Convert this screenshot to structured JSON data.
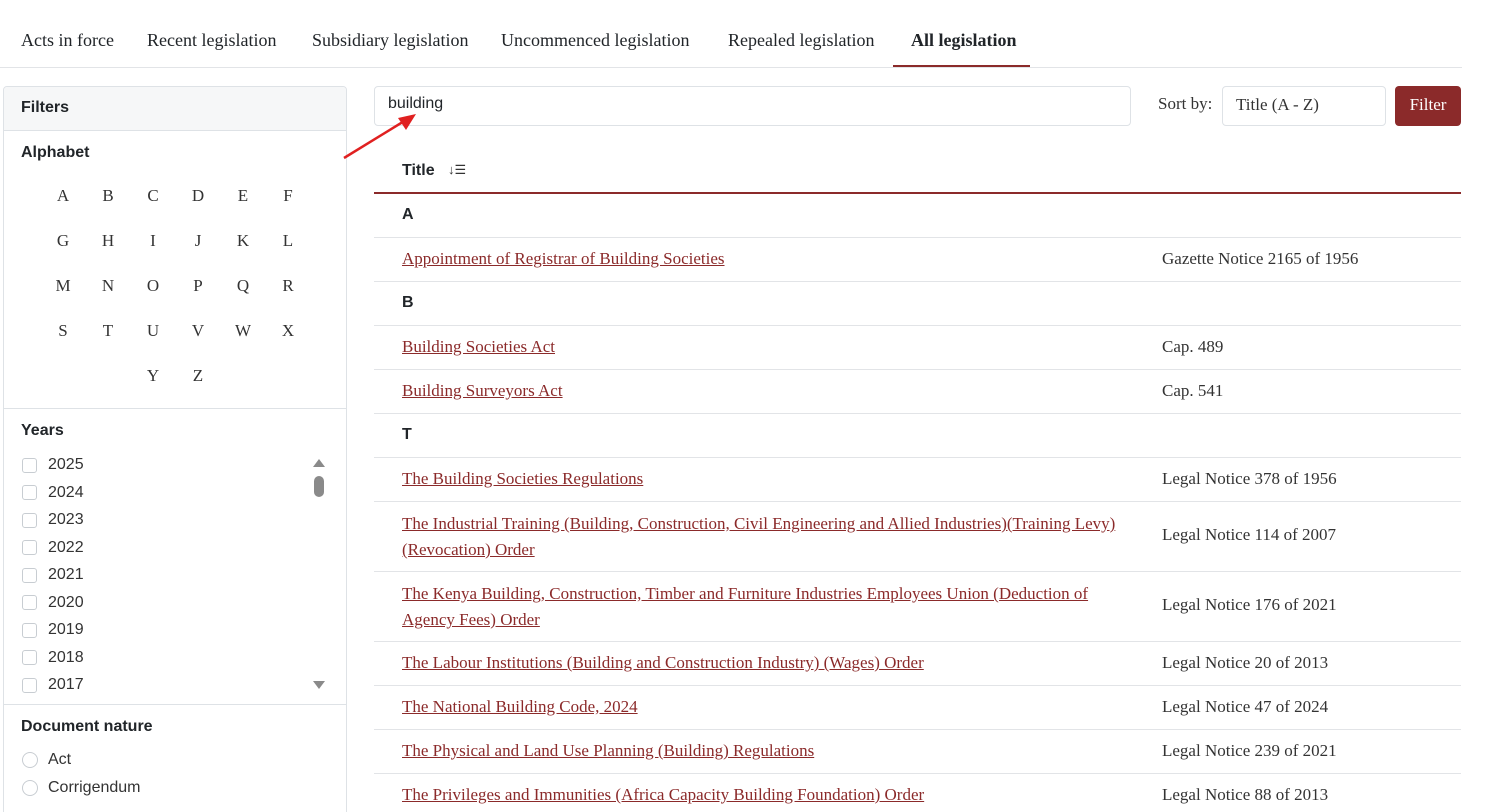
{
  "tabs": [
    {
      "label": "Acts in force"
    },
    {
      "label": "Recent legislation"
    },
    {
      "label": "Subsidiary legislation"
    },
    {
      "label": "Uncommenced legislation"
    },
    {
      "label": "Repealed legislation"
    },
    {
      "label": "All legislation",
      "active": true
    }
  ],
  "filters": {
    "header": "Filters",
    "alphabet_title": "Alphabet",
    "letters": [
      "A",
      "B",
      "C",
      "D",
      "E",
      "F",
      "G",
      "H",
      "I",
      "J",
      "K",
      "L",
      "M",
      "N",
      "O",
      "P",
      "Q",
      "R",
      "S",
      "T",
      "U",
      "V",
      "W",
      "X",
      "Y",
      "Z"
    ],
    "years_title": "Years",
    "years": [
      "2025",
      "2024",
      "2023",
      "2022",
      "2021",
      "2020",
      "2019",
      "2018",
      "2017"
    ],
    "nature_title": "Document nature",
    "natures": [
      "Act",
      "Corrigendum"
    ]
  },
  "search": {
    "value": "building"
  },
  "sort": {
    "label": "Sort by:",
    "value": "Title (A - Z)"
  },
  "filter_button": "Filter",
  "table": {
    "title_header": "Title",
    "groups": [
      {
        "letter": "A",
        "rows": [
          {
            "title": "Appointment of Registrar of Building Societies",
            "citation": "Gazette Notice 2165 of 1956"
          }
        ]
      },
      {
        "letter": "B",
        "rows": [
          {
            "title": "Building Societies Act",
            "citation": "Cap. 489"
          },
          {
            "title": "Building Surveyors Act",
            "citation": "Cap. 541"
          }
        ]
      },
      {
        "letter": "T",
        "rows": [
          {
            "title": "The Building Societies Regulations",
            "citation": "Legal Notice 378 of 1956"
          },
          {
            "title": "The Industrial Training (Building, Construction, Civil Engineering and Allied Industries)(Training Levy) (Revocation) Order",
            "citation": "Legal Notice 114 of 2007"
          },
          {
            "title": "The Kenya Building, Construction, Timber and Furniture Industries Employees Union (Deduction of Agency Fees) Order",
            "citation": "Legal Notice 176 of 2021"
          },
          {
            "title": "The Labour Institutions (Building and Construction Industry) (Wages) Order",
            "citation": "Legal Notice 20 of 2013"
          },
          {
            "title": "The National Building Code, 2024",
            "citation": "Legal Notice 47 of 2024"
          },
          {
            "title": "The Physical and Land Use Planning (Building) Regulations",
            "citation": "Legal Notice 239 of 2021"
          },
          {
            "title": "The Privileges and Immunities (Africa Capacity Building Foundation) Order",
            "citation": "Legal Notice 88 of 2013"
          }
        ]
      }
    ]
  },
  "colors": {
    "accent": "#8b2a2a",
    "border": "#dee2e6",
    "annotation_arrow": "#e02020"
  },
  "icons": {
    "sort": "sort-descending-icon",
    "arrow": "annotation-arrow-icon"
  }
}
